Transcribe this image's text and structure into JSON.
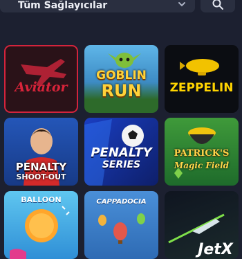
{
  "filter": {
    "provider_label": "Tüm Sağlayıcılar",
    "chevron_icon": "chevron-down-icon",
    "search_icon": "search-icon"
  },
  "games": [
    {
      "title": "Aviator",
      "subtitle": "",
      "selected": true
    },
    {
      "title": "GOBLIN",
      "subtitle": "RUN",
      "selected": false
    },
    {
      "title": "ZEPPELIN",
      "subtitle": "",
      "selected": false
    },
    {
      "title": "PENALTY",
      "subtitle": "SHOOT-OUT",
      "selected": false
    },
    {
      "title": "PENALTY",
      "subtitle": "SERIES",
      "selected": false
    },
    {
      "title": "PATRICK'S",
      "subtitle": "Magic Field",
      "selected": false
    },
    {
      "title": "BALLOON",
      "subtitle": "",
      "selected": false
    },
    {
      "title": "CAPPADOCIA",
      "subtitle": "",
      "selected": false
    },
    {
      "title": "JetX",
      "subtitle": "",
      "selected": false
    }
  ],
  "colors": {
    "background": "#1c2030",
    "control_bg": "#2a2f40",
    "selected_border": "#d3243c"
  }
}
